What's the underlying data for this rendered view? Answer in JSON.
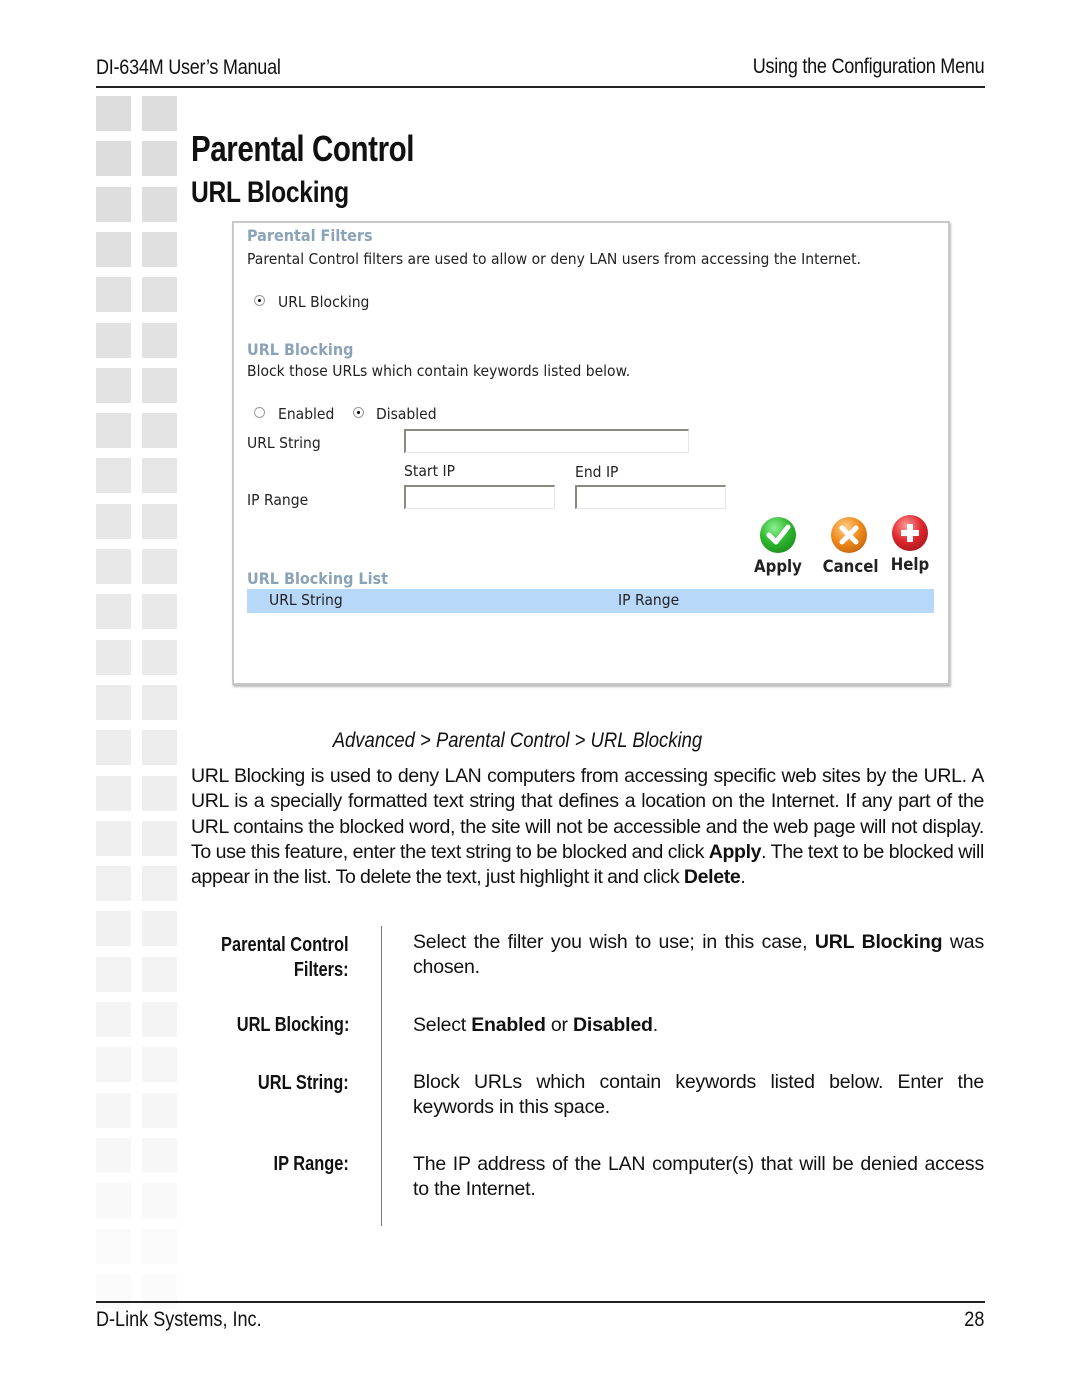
{
  "header": {
    "manual_title": "DI-634M User’s Manual",
    "section_title": "Using the Configuration Menu"
  },
  "page": {
    "title": "Parental Control",
    "subtitle": "URL Blocking"
  },
  "screenshot": {
    "parental_filters": {
      "heading": "Parental Filters",
      "description": "Parental Control filters are used to allow or deny LAN users from accessing the Internet.",
      "filter_option": {
        "label": "URL Blocking",
        "selected": true
      }
    },
    "url_blocking": {
      "heading": "URL Blocking",
      "description": "Block those URLs which contain keywords listed below.",
      "enabled_label": "Enabled",
      "disabled_label": "Disabled",
      "enabled_selected": false,
      "disabled_selected": true,
      "url_string_label": "URL String",
      "url_string_value": "",
      "start_ip_label": "Start IP",
      "end_ip_label": "End IP",
      "ip_range_label": "IP Range",
      "start_ip_value": "",
      "end_ip_value": ""
    },
    "buttons": {
      "apply": "Apply",
      "cancel": "Cancel",
      "help": "Help"
    },
    "list": {
      "heading": "URL Blocking List",
      "columns": [
        "URL String",
        "IP Range"
      ],
      "rows": []
    },
    "colors": {
      "section_heading": "#8ba3b8",
      "list_header_bg": "#b7d8f8",
      "apply_icon": "#2eb82e",
      "cancel_icon": "#f08a1c",
      "help_icon": "#e0282e"
    }
  },
  "caption": "Advanced > Parental Control > URL Blocking",
  "body": {
    "part1": "URL Blocking is used to deny LAN computers from accessing specific web sites by the URL. A URL is a specially formatted text string that defines a location on the Internet. If any part of the URL contains the blocked word, the site will not be accessible and the web page will not display. To use this feature, enter the text string to be blocked and click ",
    "bold1": "Apply",
    "part2": ". The text to be blocked  will appear in the list. To delete the text, just highlight it and click ",
    "bold2": "Delete",
    "part3": "."
  },
  "definitions": [
    {
      "term_line1": "Parental Control",
      "term_line2": "Filters:",
      "text_pre": "Select the filter you wish to use; in this case, ",
      "text_bold": "URL Blocking",
      "text_post": " was chosen."
    },
    {
      "term": "URL Blocking:",
      "text_pre": "Select ",
      "bold_a": "Enabled",
      "text_mid": " or ",
      "bold_b": "Disabled",
      "text_post": "."
    },
    {
      "term": "URL String:",
      "text": "Block URLs which contain keywords listed below. Enter the keywords in this space."
    },
    {
      "term": "IP Range:",
      "text": "The IP address of the LAN computer(s) that will be denied access to the Internet."
    }
  ],
  "footer": {
    "company": "D-Link Systems, Inc.",
    "page_number": "28"
  }
}
